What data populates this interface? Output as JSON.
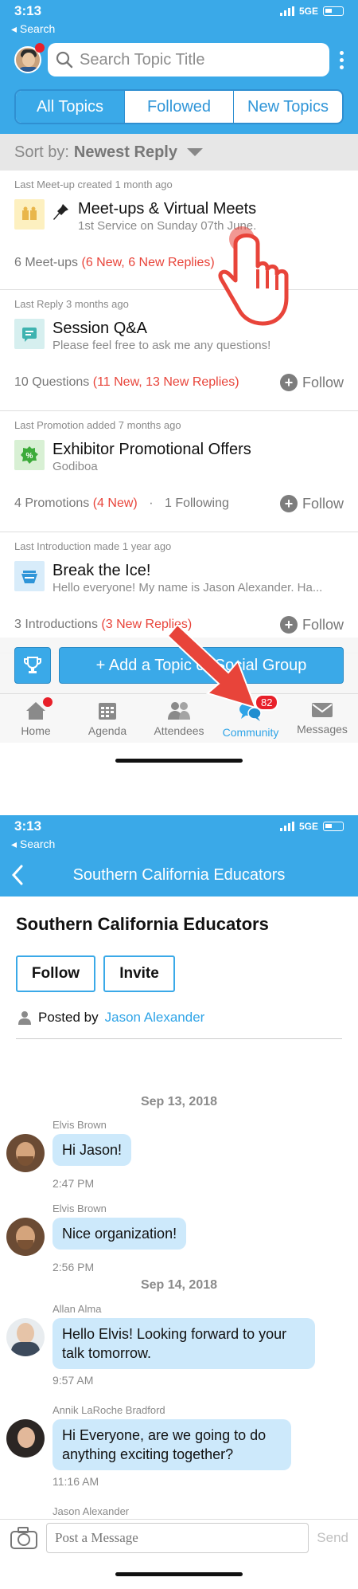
{
  "status": {
    "time": "3:13",
    "network": "5GE",
    "back_label": "◂ Search"
  },
  "community": {
    "search_placeholder": "Search Topic Title",
    "segments": [
      "All Topics",
      "Followed",
      "New Topics"
    ],
    "sort_label": "Sort by:",
    "sort_value": "Newest Reply",
    "topics": [
      {
        "meta": "Last Meet-up created 1 month ago",
        "title": "Meet-ups & Virtual Meets",
        "subtitle": "1st Service on Sunday 07th June.",
        "count": "6 Meet-ups",
        "new": "(6 New, 6 New Replies)",
        "following": "",
        "follow": "",
        "icon": "meetup-icon",
        "icon_color": "#fdf0c0",
        "pinned": true
      },
      {
        "meta": "Last Reply 3 months ago",
        "title": "Session Q&A",
        "subtitle": "Please feel free to ask me any questions!",
        "count": "10 Questions",
        "new": "(11 New, 13 New Replies)",
        "following": "",
        "follow": "Follow",
        "icon": "qa-icon",
        "icon_color": "#d6efef"
      },
      {
        "meta": "Last Promotion added 7 months ago",
        "title": "Exhibitor Promotional Offers",
        "subtitle": "Godiboa",
        "count": "4 Promotions",
        "new": "(4 New)",
        "following": "1 Following",
        "follow": "Follow",
        "icon": "promo-icon",
        "icon_color": "#d8f0d4"
      },
      {
        "meta": "Last Introduction made 1 year ago",
        "title": "Break the Ice!",
        "subtitle": "Hello everyone! My name is Jason Alexander. Ha...",
        "count": "3 Introductions",
        "new": "(3 New Replies)",
        "following": "",
        "follow": "Follow",
        "icon": "icebreak-icon",
        "icon_color": "#d8ecfa"
      }
    ],
    "add_button": "+ Add a Topic or Social Group",
    "tabs": [
      {
        "label": "Home",
        "icon": "home-icon"
      },
      {
        "label": "Agenda",
        "icon": "calendar-icon"
      },
      {
        "label": "Attendees",
        "icon": "people-icon"
      },
      {
        "label": "Community",
        "icon": "chat-bubbles-icon",
        "badge": "82"
      },
      {
        "label": "Messages",
        "icon": "envelope-icon"
      }
    ]
  },
  "group": {
    "nav_title": "Southern California Educators",
    "title": "Southern California Educators",
    "follow_button": "Follow",
    "invite_button": "Invite",
    "posted_by_label": "Posted by",
    "posted_by_name": "Jason Alexander",
    "dates": [
      "Sep 13, 2018",
      "Sep 14, 2018"
    ],
    "messages": [
      {
        "author": "Elvis Brown",
        "text": "Hi Jason!",
        "time": "2:47 PM"
      },
      {
        "author": "Elvis Brown",
        "text": "Nice organization!",
        "time": "2:56 PM"
      },
      {
        "author": "Allan Alma",
        "text": "Hello Elvis! Looking forward to your talk tomorrow.",
        "time": "9:57 AM"
      },
      {
        "author": "Annik LaRoche Bradford",
        "text": "Hi Everyone, are we going to do anything exciting together?",
        "time": "11:16 AM"
      },
      {
        "author": "Jason Alexander",
        "text": "",
        "time": ""
      }
    ],
    "composer_placeholder": "Post a Message",
    "send_label": "Send"
  }
}
